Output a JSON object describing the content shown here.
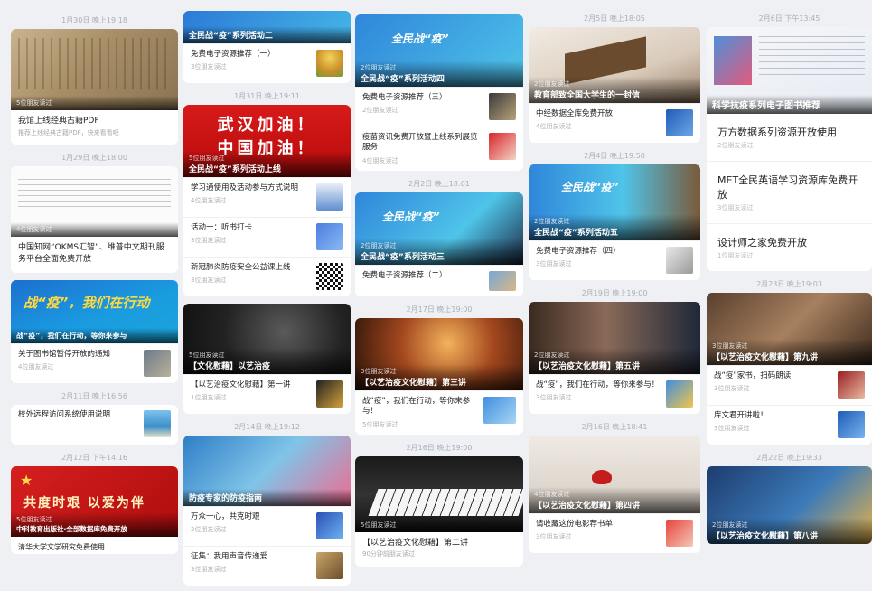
{
  "col1": {
    "date1": "1月30日 晚上19:18",
    "book_card": {
      "reads": "5位朋友读过",
      "title": "我馆上线经典古籍PDF",
      "sub": "推荐上线经典古籍PDF，快来看看吧"
    },
    "date2": "1月29日 晚上18:00",
    "cnki_card": {
      "reads": "4位朋友读过",
      "title": "中国知网“OKMS汇智”、维普中文期刊服务平台全面免费开放"
    },
    "fight_card": {
      "banner": "战“疫”，我们在行动",
      "caption": "战“疫”，我们在行动，等你来参与",
      "title": "关于图书馆暂停开放的通知",
      "reads": "4位朋友读过"
    },
    "date3": "2月11日 晚上16:56",
    "vpn_card": {
      "title": "校外远程访问系统使用说明"
    },
    "date4": "2月12日 下午14:16",
    "red_card": {
      "banner": "共度时艰 以爱为伴",
      "reads": "5位朋友读过",
      "caption": "中科教育出版社·全部数据库免费开放",
      "next": "清华大学文学研究免费使用"
    }
  },
  "col2": {
    "top_card": {
      "caption": "全民战“疫”系列活动二",
      "title": "免费电子资源推荐（一）",
      "reads": "3位朋友读过"
    },
    "date1": "1月31日 晚上19:11",
    "wuhan_card": {
      "line1": "武汉加油！",
      "line2": "中国加油！",
      "reads": "5位朋友读过",
      "caption": "全民战“疫”系列活动上线",
      "items": [
        {
          "title": "学习通使用及活动参与方式说明",
          "reads": "4位朋友读过"
        },
        {
          "title": "活动一：听书打卡",
          "reads": "3位朋友读过"
        },
        {
          "title": "新冠肺炎防疫安全公益课上线",
          "reads": "3位朋友读过"
        }
      ]
    },
    "music_card": {
      "reads": "5位朋友读过",
      "caption": "【文化慰藉】以艺治疫",
      "title": "【以艺治疫文化慰藉】第一讲",
      "reads2": "1位朋友读过"
    },
    "date2": "2月14日 晚上19:12",
    "doctor_card": {
      "caption": "防疫专家的防疫指南",
      "items": [
        {
          "title": "万众一心，共克时艰",
          "reads": "2位朋友读过"
        },
        {
          "title": "征集：我用声音传递爱",
          "reads": "3位朋友读过"
        }
      ]
    }
  },
  "col3": {
    "top_card": {
      "banner": "全民战“疫”",
      "reads": "2位朋友读过",
      "caption": "全民战“疫”系列活动四",
      "items": [
        {
          "title": "免费电子资源推荐（三）",
          "reads": "2位朋友读过"
        },
        {
          "title": "疫苗资讯免费开放暨上线系列展览服务",
          "reads": "4位朋友读过"
        }
      ]
    },
    "date1": "2月2日 晚上18:01",
    "act3_card": {
      "banner": "全民战“疫”",
      "reads": "2位朋友读过",
      "caption": "全民战“疫”系列活动三",
      "title": "免费电子资源推荐（二）"
    },
    "date2": "2月17日 晚上19:00",
    "concert_card": {
      "reads": "3位朋友读过",
      "caption": "【以艺治疫文化慰藉】第三讲",
      "title": "战“疫”，我们在行动，等你来参与！",
      "reads2": "5位朋友读过"
    },
    "date3": "2月16日 晚上19:00",
    "piano_card": {
      "reads": "5位朋友读过",
      "title": "【以艺治疫文化慰藉】第二讲",
      "reads2": "90分钟前朋友读过"
    }
  },
  "col4": {
    "date1": "2月5日 晚上18:05",
    "letter_card": {
      "reads": "2位朋友读过",
      "caption": "教育部致全国大学生的一封信",
      "title": "中经数据全库免费开放",
      "reads2": "4位朋友读过"
    },
    "date2": "2月4日 晚上19:50",
    "act5_card": {
      "banner": "全民战“疫”",
      "reads": "2位朋友读过",
      "caption": "全民战“疫”系列活动五",
      "title": "免费电子资源推荐（四）",
      "reads2": "3位朋友读过"
    },
    "date3": "2月19日 晚上19:00",
    "grammy_card": {
      "reads": "2位朋友读过",
      "caption": "【以艺治疫文化慰藉】第五讲",
      "title": "战“疫”，我们在行动，等你来参与！",
      "reads2": "3位朋友读过"
    },
    "date4": "2月16日 晚上18:41",
    "tea_card": {
      "reads": "4位朋友读过",
      "caption": "【以艺治疫文化慰藉】第四讲",
      "title": "请收藏这份电影荐书单",
      "reads2": "3位朋友读过"
    }
  },
  "col5": {
    "date1": "2月6日 下午13:45",
    "sci_card": {
      "caption": "科学抗疫系列电子图书推荐",
      "items": [
        {
          "title": "万方数据系列资源开放使用",
          "reads": "2位朋友读过"
        },
        {
          "title": "MET全民英语学习资源库免费开放",
          "reads": "3位朋友读过"
        },
        {
          "title": "设计师之家免费开放",
          "reads": "1位朋友读过"
        }
      ]
    },
    "date2": "2月23日 晚上19:03",
    "guzheng_card": {
      "reads": "3位朋友读过",
      "caption": "【以艺治疫文化慰藉】第九讲",
      "items": [
        {
          "title": "战“疫”家书，扫码朗读",
          "reads": "3位朋友读过"
        },
        {
          "title": "库文君开讲啦！",
          "reads": "3位朋友读过"
        }
      ]
    },
    "date3": "2月22日 晚上19:33",
    "pipa_card": {
      "reads": "2位朋友读过",
      "caption": "【以艺治疫文化慰藉】第八讲"
    }
  }
}
